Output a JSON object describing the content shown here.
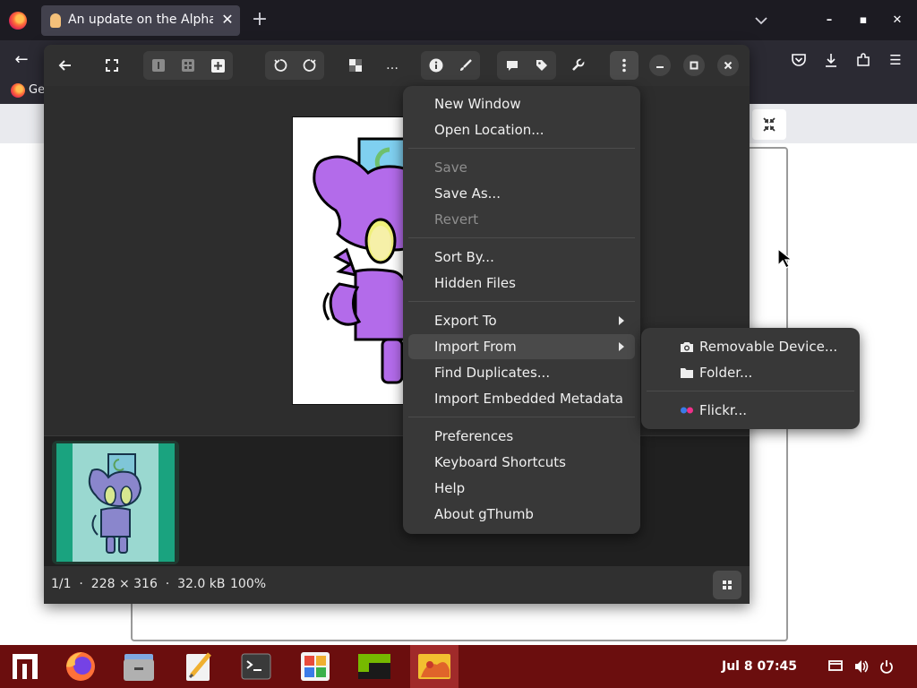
{
  "browser": {
    "tab_title": "An update on the Alpha",
    "tab_close": "✕",
    "new_tab": "+",
    "bookmark_label": "Ge"
  },
  "gthumb": {
    "status_text": "1/1  ·  228 × 316  ·  32.0 kB",
    "zoom": "100%",
    "more_label": "…"
  },
  "menu": {
    "new_window": "New Window",
    "open_location": "Open Location...",
    "save": "Save",
    "save_as": "Save As...",
    "revert": "Revert",
    "sort_by": "Sort By...",
    "hidden_files": "Hidden Files",
    "export_to": "Export To",
    "import_from": "Import From",
    "find_duplicates": "Find Duplicates...",
    "import_metadata": "Import Embedded Metadata",
    "preferences": "Preferences",
    "keyboard_shortcuts": "Keyboard Shortcuts",
    "help": "Help",
    "about": "About gThumb"
  },
  "submenu": {
    "removable_device": "Removable Device...",
    "folder": "Folder...",
    "flickr": "Flickr..."
  },
  "taskbar": {
    "clock": "Jul 8  07:45"
  },
  "colors": {
    "taskbar_bg": "#6b0e0e",
    "menu_bg": "#383838",
    "thumb_bg": "#1aa37f",
    "character_purple": "#b36bea"
  }
}
